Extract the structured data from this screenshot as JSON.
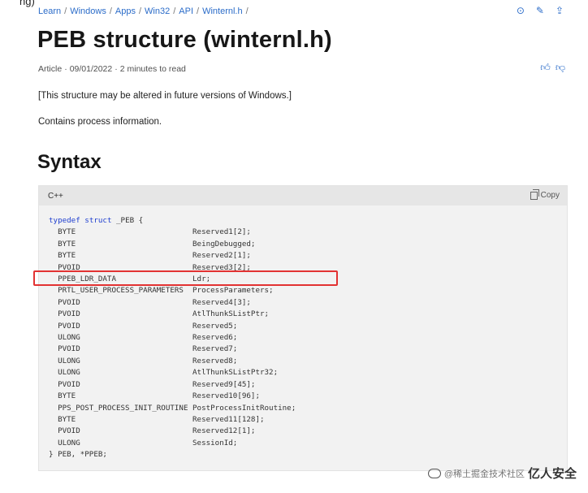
{
  "caption": "ng)",
  "breadcrumb": [
    "Learn",
    "Windows",
    "Apps",
    "Win32",
    "API",
    "Winternl.h"
  ],
  "title": "PEB structure (winternl.h)",
  "meta": {
    "type": "Article",
    "date": "09/01/2022",
    "read_time": "2 minutes to read"
  },
  "note": "[This structure may be altered in future versions of Windows.]",
  "description": "Contains process information.",
  "section_heading": "Syntax",
  "code": {
    "language": "C++",
    "copy_label": "Copy",
    "open_line": {
      "keyword1": "typedef",
      "keyword2": "struct",
      "rest": " _PEB {"
    },
    "fields": [
      {
        "type": "BYTE",
        "name": "Reserved1[2];"
      },
      {
        "type": "BYTE",
        "name": "BeingDebugged;"
      },
      {
        "type": "BYTE",
        "name": "Reserved2[1];"
      },
      {
        "type": "PVOID",
        "name": "Reserved3[2];"
      },
      {
        "type": "PPEB_LDR_DATA",
        "name": "Ldr;"
      },
      {
        "type": "PRTL_USER_PROCESS_PARAMETERS",
        "name": "ProcessParameters;"
      },
      {
        "type": "PVOID",
        "name": "Reserved4[3];"
      },
      {
        "type": "PVOID",
        "name": "AtlThunkSListPtr;"
      },
      {
        "type": "PVOID",
        "name": "Reserved5;"
      },
      {
        "type": "ULONG",
        "name": "Reserved6;"
      },
      {
        "type": "PVOID",
        "name": "Reserved7;"
      },
      {
        "type": "ULONG",
        "name": "Reserved8;"
      },
      {
        "type": "ULONG",
        "name": "AtlThunkSListPtr32;"
      },
      {
        "type": "PVOID",
        "name": "Reserved9[45];"
      },
      {
        "type": "BYTE",
        "name": "Reserved10[96];"
      },
      {
        "type": "PPS_POST_PROCESS_INIT_ROUTINE",
        "name": "PostProcessInitRoutine;"
      },
      {
        "type": "BYTE",
        "name": "Reserved11[128];"
      },
      {
        "type": "PVOID",
        "name": "Reserved12[1];"
      },
      {
        "type": "ULONG",
        "name": "SessionId;"
      }
    ],
    "close_line": "} PEB, *PPEB;"
  },
  "watermark": {
    "handle": "@稀土掘金技术社区",
    "text": "亿人安全"
  },
  "colors": {
    "link": "#2b6cc9",
    "keyword": "#1e3ecf",
    "highlight": "#e23232"
  }
}
